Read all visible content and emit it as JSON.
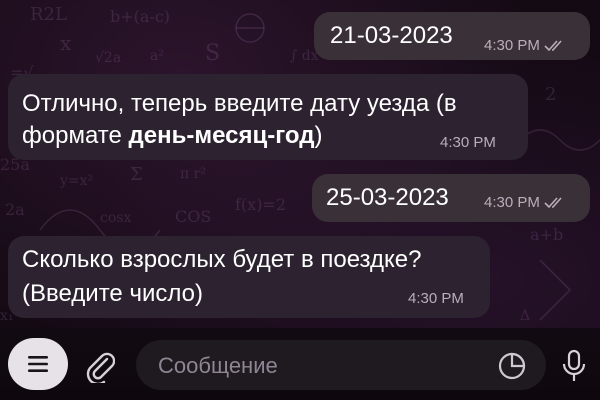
{
  "messages": [
    {
      "direction": "outgoing",
      "text": "21-03-2023",
      "time": "4:30 PM",
      "status": "read"
    },
    {
      "direction": "incoming",
      "line1": "Отлично, теперь введите дату уезда (в",
      "line2_prefix": "формате ",
      "line2_bold": "день-месяц-год",
      "line2_suffix": ")",
      "time": "4:30 PM"
    },
    {
      "direction": "outgoing",
      "text": "25-03-2023",
      "time": "4:30 PM",
      "status": "read"
    },
    {
      "direction": "incoming",
      "line1": "Сколько взрослых будет в поездке?",
      "line2": "(Введите число)",
      "time": "4:30 PM"
    }
  ],
  "composer": {
    "placeholder": "Сообщение",
    "menu_icon": "menu-icon",
    "attach_icon": "paperclip-icon",
    "sticker_icon": "sticker-icon",
    "mic_icon": "microphone-icon"
  },
  "colors": {
    "bubble_incoming": "#2c2230",
    "bubble_outgoing": "#3a3038",
    "background": "#140a14"
  }
}
